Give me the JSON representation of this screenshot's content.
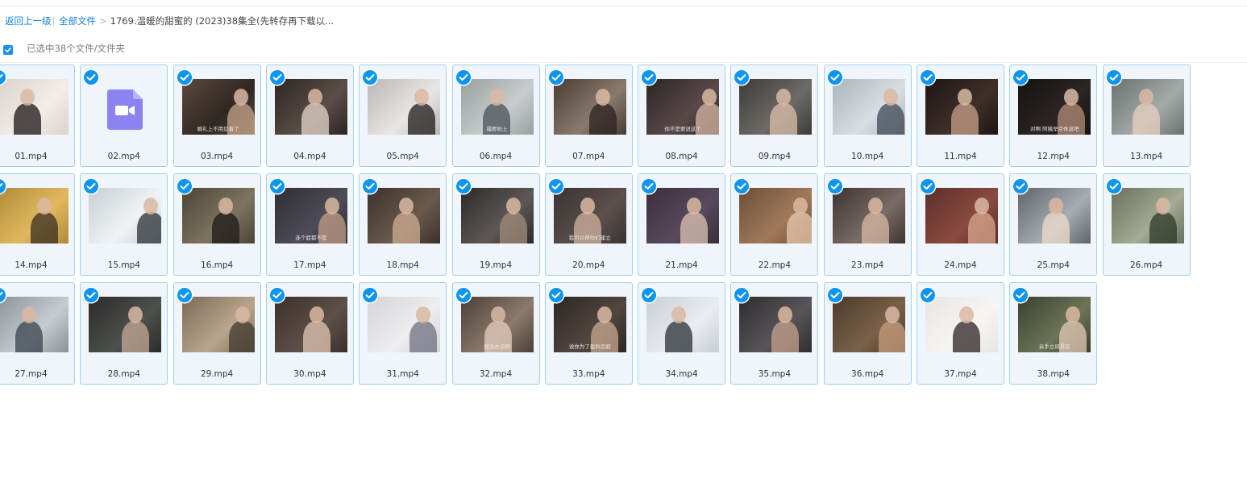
{
  "breadcrumb": {
    "back": "返回上一级",
    "all_files": "全部文件",
    "current_folder": "1769.温暖的甜蜜的 (2023)38集全(先转存再下载以..."
  },
  "selection": {
    "text": "已选中38个文件/文件夹",
    "all_checked": true
  },
  "colors": {
    "accent": "#0d95ef",
    "tile_border": "#9dd0f5",
    "tile_bg": "#f0f5fb",
    "video_icon": "#8b83f0"
  },
  "files": [
    {
      "name": "01.mp4",
      "subtitle": ""
    },
    {
      "name": "02.mp4",
      "subtitle": "",
      "icon": "video-file-icon"
    },
    {
      "name": "03.mp4",
      "subtitle": "婚礼上不用见着了"
    },
    {
      "name": "04.mp4",
      "subtitle": ""
    },
    {
      "name": "05.mp4",
      "subtitle": ""
    },
    {
      "name": "06.mp4",
      "subtitle": "撮要始上"
    },
    {
      "name": "07.mp4",
      "subtitle": ""
    },
    {
      "name": "08.mp4",
      "subtitle": "你不是要说这个"
    },
    {
      "name": "09.mp4",
      "subtitle": ""
    },
    {
      "name": "10.mp4",
      "subtitle": ""
    },
    {
      "name": "11.mp4",
      "subtitle": ""
    },
    {
      "name": "12.mp4",
      "subtitle": "对啊 阿姨早点休息吧"
    },
    {
      "name": "13.mp4",
      "subtitle": ""
    },
    {
      "name": "14.mp4",
      "subtitle": ""
    },
    {
      "name": "15.mp4",
      "subtitle": ""
    },
    {
      "name": "16.mp4",
      "subtitle": ""
    },
    {
      "name": "17.mp4",
      "subtitle": "连个屁都不是"
    },
    {
      "name": "18.mp4",
      "subtitle": ""
    },
    {
      "name": "19.mp4",
      "subtitle": ""
    },
    {
      "name": "20.mp4",
      "subtitle": "我可以帮你们建立"
    },
    {
      "name": "21.mp4",
      "subtitle": ""
    },
    {
      "name": "22.mp4",
      "subtitle": ""
    },
    {
      "name": "23.mp4",
      "subtitle": ""
    },
    {
      "name": "24.mp4",
      "subtitle": ""
    },
    {
      "name": "25.mp4",
      "subtitle": ""
    },
    {
      "name": "26.mp4",
      "subtitle": ""
    },
    {
      "name": "27.mp4",
      "subtitle": ""
    },
    {
      "name": "28.mp4",
      "subtitle": ""
    },
    {
      "name": "29.mp4",
      "subtitle": ""
    },
    {
      "name": "30.mp4",
      "subtitle": ""
    },
    {
      "name": "31.mp4",
      "subtitle": ""
    },
    {
      "name": "32.mp4",
      "subtitle": "我没办法啊"
    },
    {
      "name": "33.mp4",
      "subtitle": "说你为了盈利造假"
    },
    {
      "name": "34.mp4",
      "subtitle": ""
    },
    {
      "name": "35.mp4",
      "subtitle": ""
    },
    {
      "name": "36.mp4",
      "subtitle": ""
    },
    {
      "name": "37.mp4",
      "subtitle": ""
    },
    {
      "name": "38.mp4",
      "subtitle": "亲手立风景区"
    }
  ]
}
